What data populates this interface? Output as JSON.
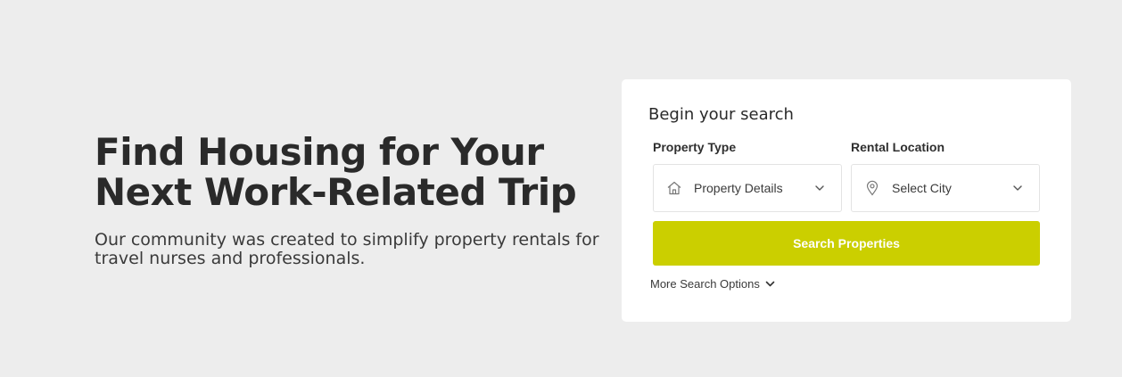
{
  "hero": {
    "title": "Find Housing for Your Next Work-Related Trip",
    "subtitle": "Our community was created to simplify property rentals for travel nurses and professionals."
  },
  "search": {
    "heading": "Begin your search",
    "property_type": {
      "label": "Property Type",
      "value": "Property Details",
      "icon": "home-icon"
    },
    "rental_location": {
      "label": "Rental Location",
      "value": "Select City",
      "icon": "map-pin-icon"
    },
    "submit_label": "Search Properties",
    "more_options_label": "More Search Options"
  },
  "colors": {
    "background": "#ededed",
    "card": "#ffffff",
    "accent": "#cbcf00"
  }
}
